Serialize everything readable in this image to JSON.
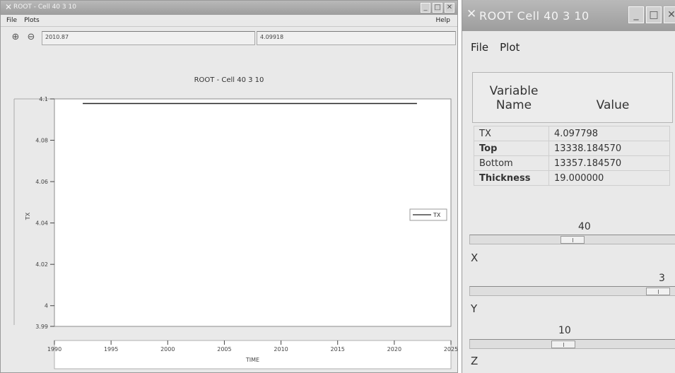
{
  "main_window": {
    "title": "ROOT - Cell 40 3 10",
    "menu": {
      "file": "File",
      "plots": "Plots",
      "help": "Help"
    },
    "toolbar": {
      "coord_x": "2010.87",
      "coord_y": "4.09918"
    },
    "plot_title": "ROOT - Cell 40 3 10"
  },
  "chart_data": {
    "type": "line",
    "title": "ROOT - Cell 40 3 10",
    "xlabel": "TIME",
    "ylabel": "TX",
    "xlim": [
      1990,
      2025
    ],
    "ylim": [
      3.99,
      4.1
    ],
    "x_ticks": [
      "1990",
      "1995",
      "2000",
      "2005",
      "2010",
      "2015",
      "2020",
      "2025"
    ],
    "y_ticks": [
      "3.99",
      "4",
      "4.02",
      "4.04",
      "4.06",
      "4.08",
      "4.1"
    ],
    "series": [
      {
        "name": "TX",
        "x": [
          1992.5,
          2022
        ],
        "y": [
          4.0978,
          4.0978
        ],
        "color": "#222222"
      }
    ],
    "legend": "right"
  },
  "cell_window": {
    "title": "ROOT   Cell 40 3 10",
    "menu": {
      "file": "File",
      "plot": "Plot"
    },
    "table": {
      "header_variable": "Variable\nName",
      "header_value": "Value",
      "rows": [
        {
          "name": "TX",
          "value": "4.097798"
        },
        {
          "name": "Top",
          "value": "13338.184570"
        },
        {
          "name": "Bottom",
          "value": "13357.184570"
        },
        {
          "name": "Thickness",
          "value": "19.000000"
        }
      ]
    },
    "sliders": [
      {
        "label": "X",
        "value": "40",
        "level": 0.5
      },
      {
        "label": "Y",
        "value": "3",
        "level": 0.96
      },
      {
        "label": "Z",
        "value": "10",
        "level": 0.45
      }
    ]
  }
}
